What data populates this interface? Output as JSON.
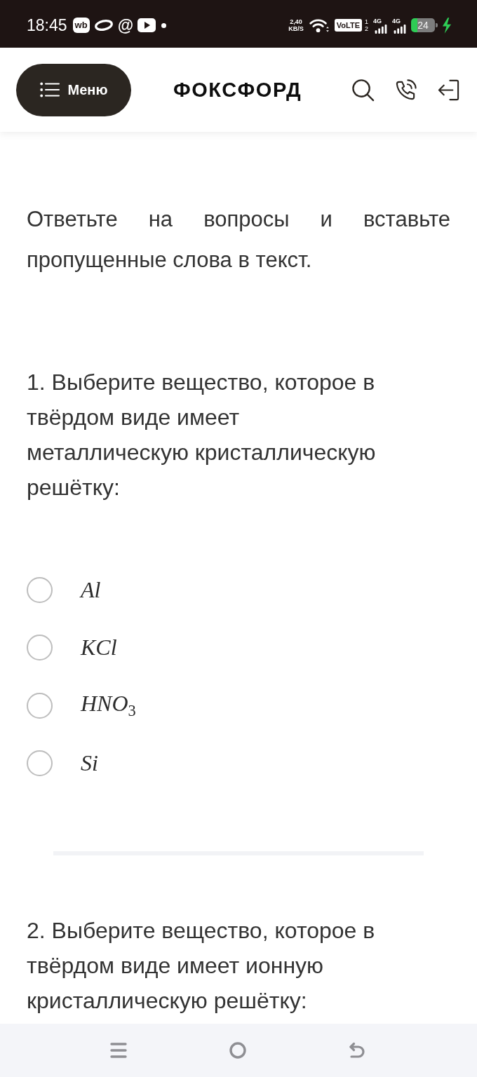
{
  "status_bar": {
    "time": "18:45",
    "notifications": [
      {
        "kind": "badge",
        "label": "wb"
      },
      {
        "kind": "ring"
      },
      {
        "kind": "glyph",
        "label": "@"
      },
      {
        "kind": "play"
      },
      {
        "kind": "dot"
      }
    ],
    "speed": {
      "value": "2,40",
      "unit": "KB/S"
    },
    "volte": "VoLTE",
    "sim_slots": [
      "1",
      "2"
    ],
    "networks": [
      "4G",
      "4G"
    ],
    "battery": "24",
    "charging": true
  },
  "header": {
    "menu_button": "Меню",
    "logo": "ФОКСФОРД"
  },
  "instructions": "Ответьте на вопросы и вставьте пропущенные слова в текст.",
  "questions": [
    {
      "text": "1. Выберите вещество, которое в твёрдом виде имеет металлическую кристаллическую решётку:",
      "options": [
        {
          "label": "Al",
          "selected": false
        },
        {
          "label": "KCl",
          "selected": false
        },
        {
          "label": "HNO$_{3}$",
          "selected": false
        },
        {
          "label": "Si",
          "selected": false
        }
      ]
    },
    {
      "text": "2. Выберите вещество, которое в твёрдом виде имеет ионную кристаллическую решётку:"
    }
  ]
}
